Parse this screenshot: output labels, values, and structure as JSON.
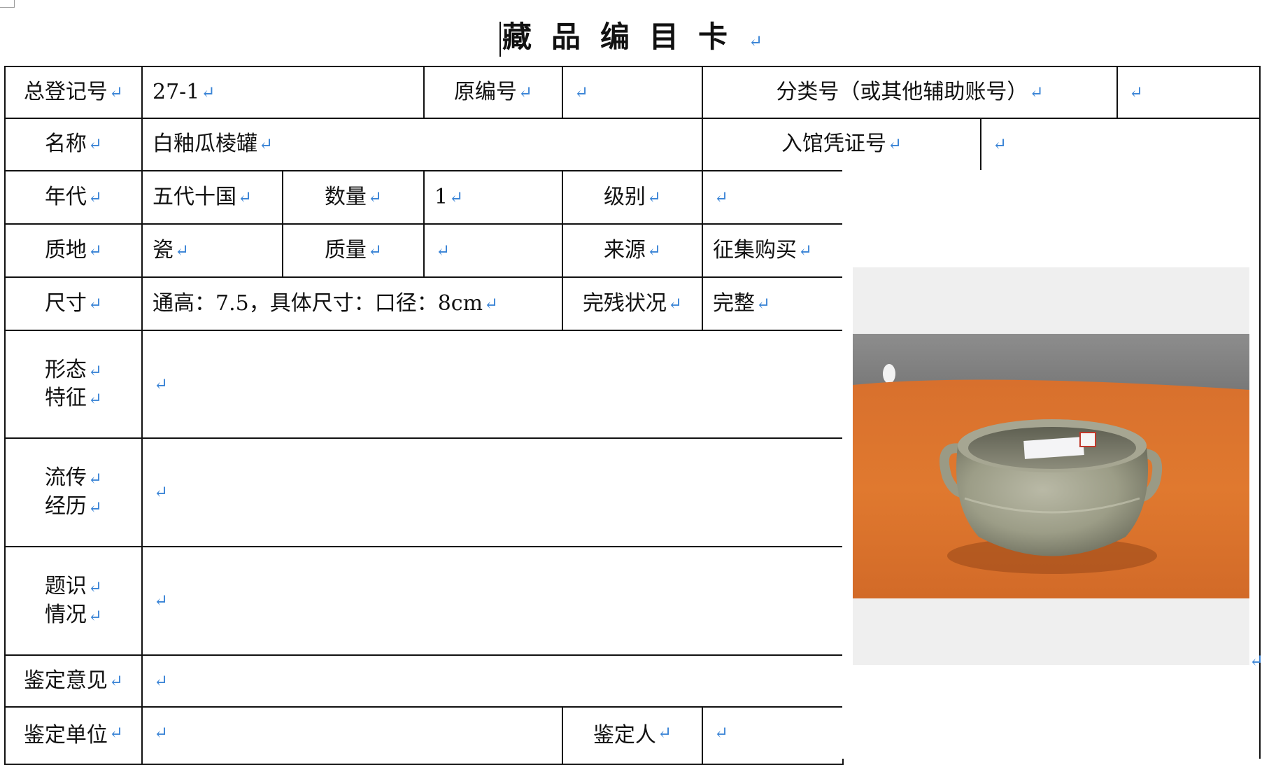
{
  "title": "藏品编目卡",
  "return_mark": "↵",
  "rows": {
    "r1": {
      "reg_label": "总登记号",
      "reg_value": "27-1",
      "orig_label": "原编号",
      "orig_value": "",
      "class_label": "分类号（或其他辅助账号）",
      "class_value": ""
    },
    "r2": {
      "name_label": "名称",
      "name_value": "白釉瓜棱罐",
      "cert_label": "入馆凭证号",
      "cert_value": ""
    },
    "r3": {
      "era_label": "年代",
      "era_value": "五代十国",
      "qty_label": "数量",
      "qty_value": "1",
      "grade_label": "级别",
      "grade_value": ""
    },
    "r4": {
      "material_label": "质地",
      "material_value": "瓷",
      "weight_label": "质量",
      "weight_value": "",
      "source_label": "来源",
      "source_value": "征集购买"
    },
    "r5": {
      "size_label": "尺寸",
      "size_value": "通高：7.5，具体尺寸：口径：8cm",
      "cond_label": "完残状况",
      "cond_value": "完整"
    },
    "r6": {
      "label_1": "形态",
      "label_2": "特征",
      "value": ""
    },
    "r7": {
      "label_1": "流传",
      "label_2": "经历",
      "value": ""
    },
    "r8": {
      "label_1": "题识",
      "label_2": "情况",
      "value": ""
    },
    "r9": {
      "label": "鉴定意见",
      "value": ""
    },
    "r10": {
      "unit_label": "鉴定单位",
      "unit_value": "",
      "person_label": "鉴定人",
      "person_value": ""
    }
  },
  "photo": {
    "subject": "gray-glazed two-handled ceramic jar on orange cloth"
  },
  "colors": {
    "border": "#111111",
    "mark": "#3a84d6",
    "cloth": "#e0762f",
    "backdrop": "#8a8a8a"
  }
}
